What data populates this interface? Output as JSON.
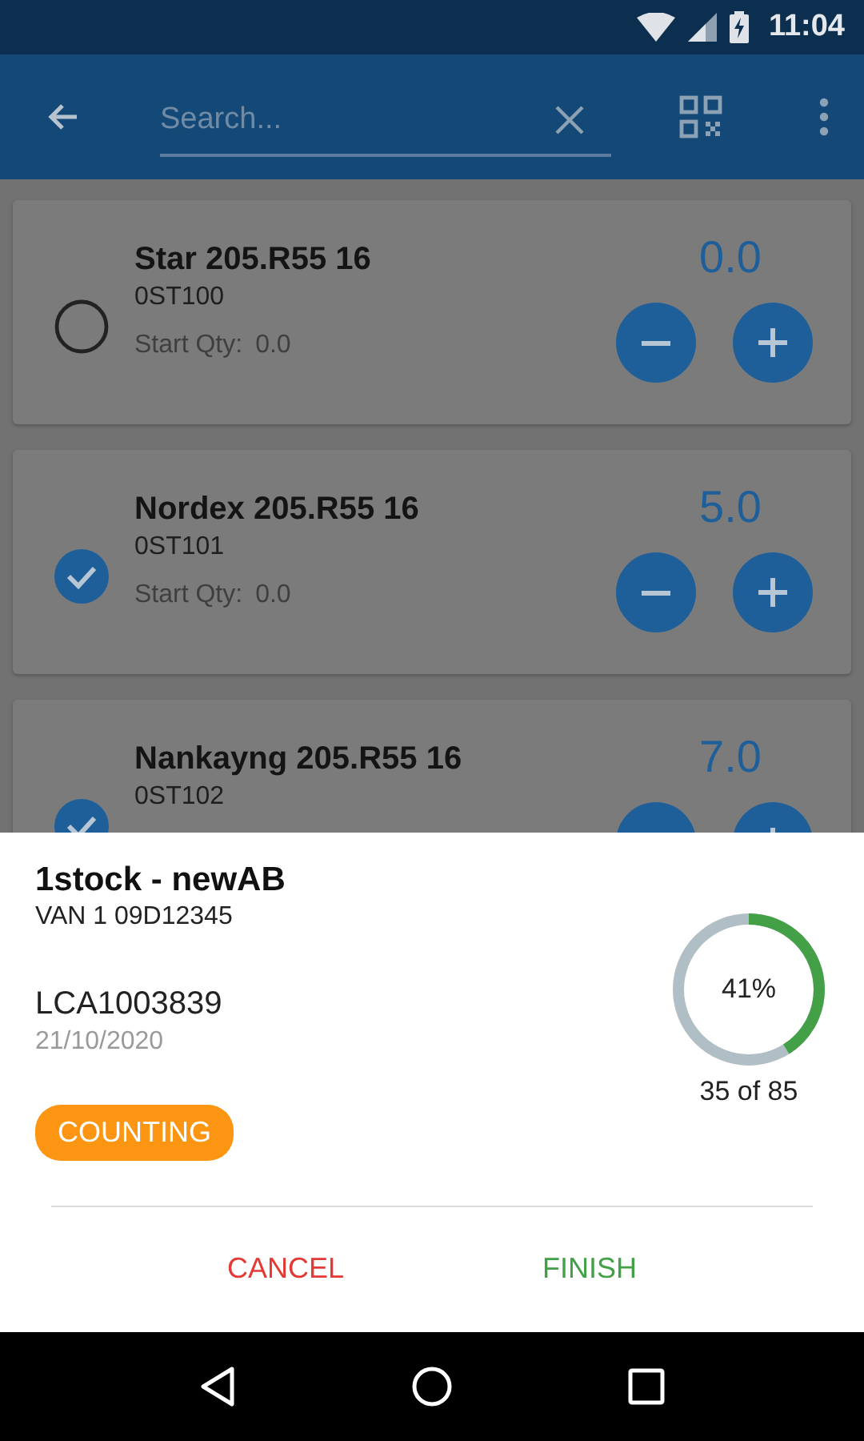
{
  "status_bar": {
    "time": "11:04"
  },
  "toolbar": {
    "search": {
      "placeholder": "Search..."
    }
  },
  "items": [
    {
      "name": "Star 205.R55 16",
      "code": "0ST100",
      "start_label": "Start Qty:",
      "start_qty": "0.0",
      "quantity": "0.0",
      "checked": false
    },
    {
      "name": "Nordex 205.R55 16",
      "code": "0ST101",
      "start_label": "Start Qty:",
      "start_qty": "0.0",
      "quantity": "5.0",
      "checked": true
    },
    {
      "name": "Nankayng 205.R55 16",
      "code": "0ST102",
      "quantity": "7.0",
      "checked": true
    }
  ],
  "sheet": {
    "title": "1stock - newAB",
    "subtitle": "VAN 1 09D12345",
    "reference": "LCA1003839",
    "date": "21/10/2020",
    "status": "COUNTING",
    "progress": {
      "level": 0.41,
      "percent": "41%",
      "count": "35 of 85"
    },
    "buttons": [
      {
        "label": "CANCEL",
        "kind": "cancel"
      },
      {
        "label": "FINISH",
        "kind": "finish"
      }
    ]
  }
}
